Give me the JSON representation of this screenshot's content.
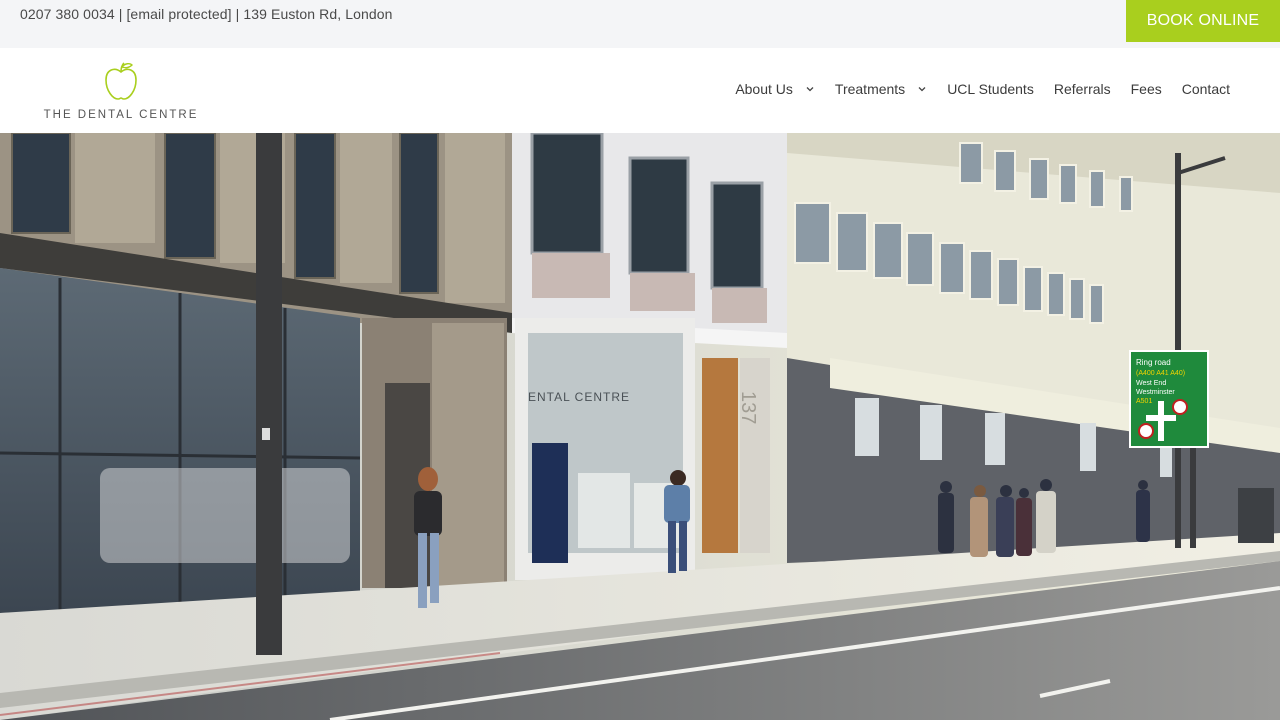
{
  "topbar": {
    "contact_text": "0207 380 0034 | [email protected] | 139 Euston Rd, London",
    "book_label": "BOOK ONLINE"
  },
  "header": {
    "logo_text": "THE DENTAL CENTRE",
    "nav": [
      {
        "label": "About Us",
        "has_dropdown": true
      },
      {
        "label": "Treatments",
        "has_dropdown": true
      },
      {
        "label": "UCL Students",
        "has_dropdown": false
      },
      {
        "label": "Referrals",
        "has_dropdown": false
      },
      {
        "label": "Fees",
        "has_dropdown": false
      },
      {
        "label": "Contact",
        "has_dropdown": false
      }
    ]
  },
  "hero": {
    "shop_sign": "ENTAL CENTRE",
    "door_number": "137",
    "road_sign": {
      "line1": "Ring road",
      "line2": "(A400 A41 A40)",
      "line3": "West End",
      "line4": "Westminster",
      "line5": "A501"
    }
  },
  "colors": {
    "accent": "#a9cf1e",
    "topbar_bg": "#f4f5f7",
    "road_sign": "#1f8a3c"
  }
}
